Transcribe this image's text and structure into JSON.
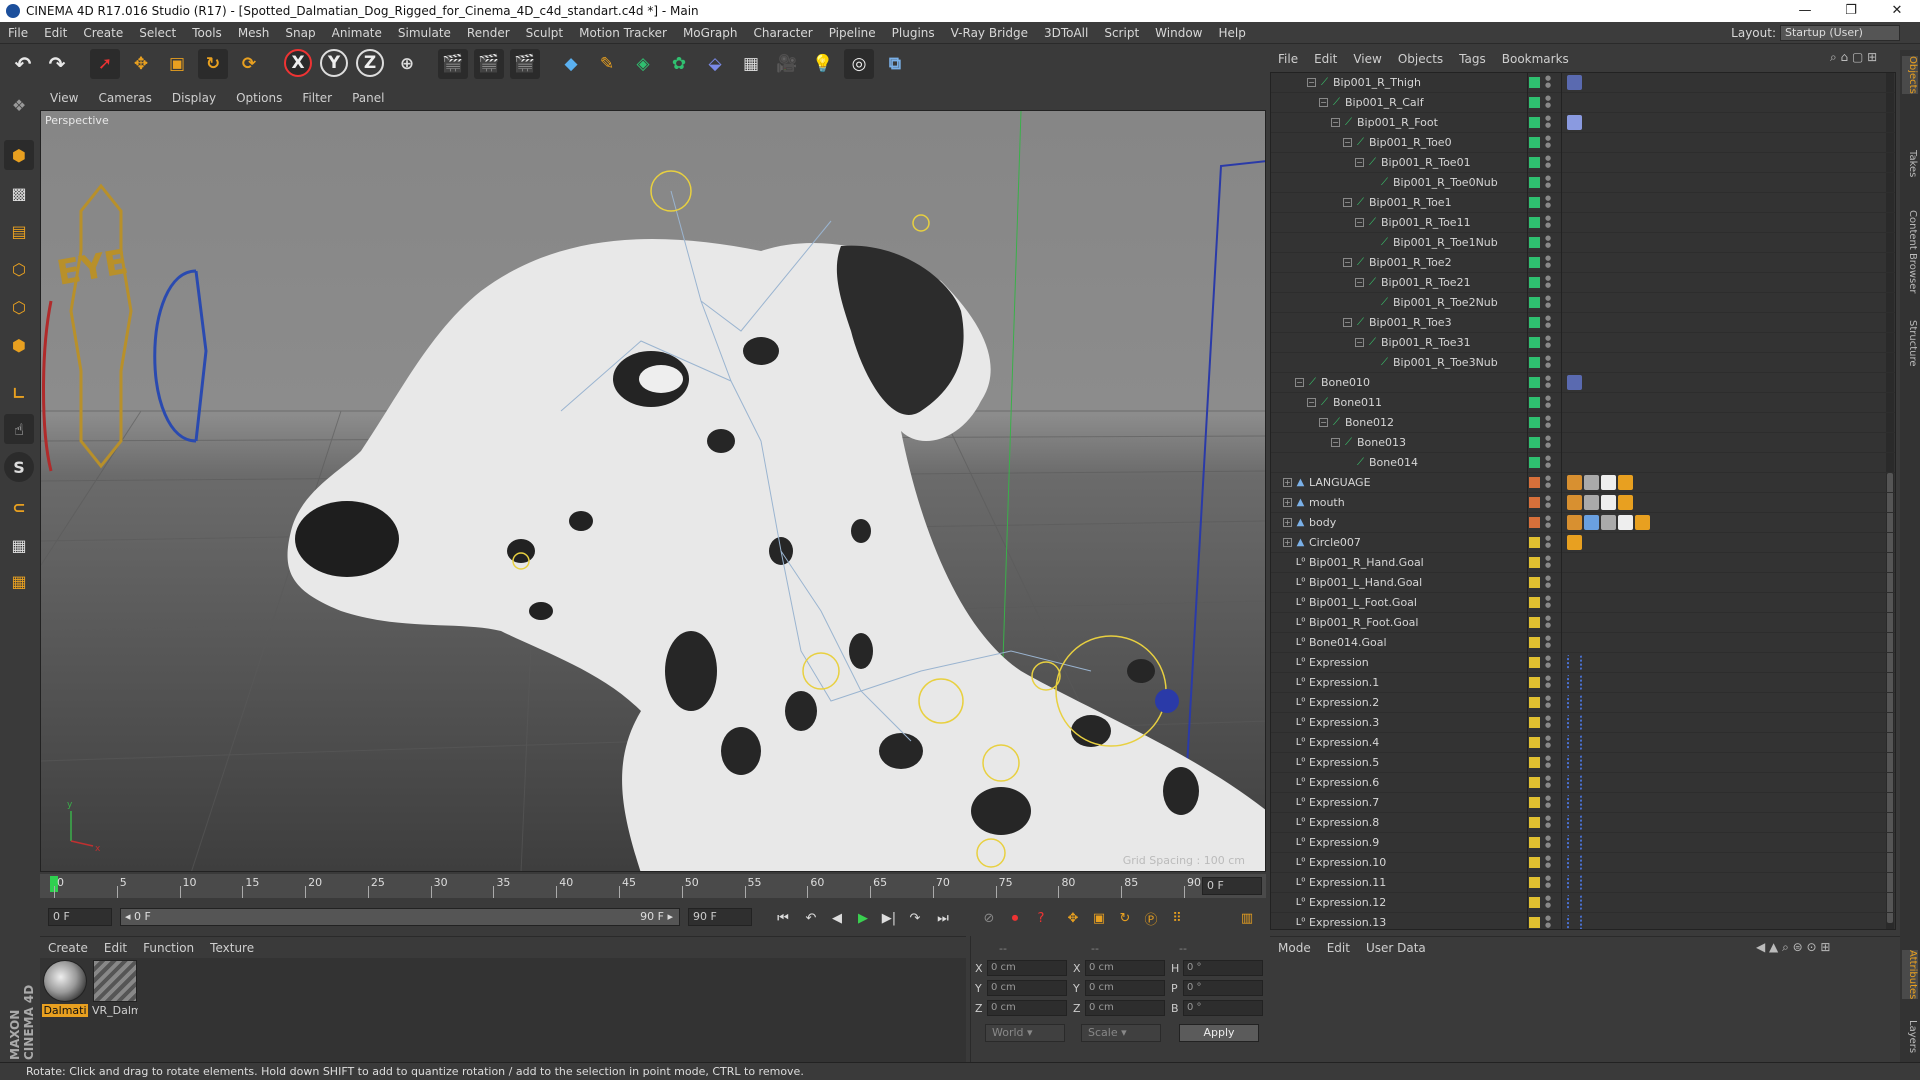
{
  "window": {
    "title": "CINEMA 4D R17.016 Studio (R17) - [Spotted_Dalmatian_Dog_Rigged_for_Cinema_4D_c4d_standart.c4d *] - Main",
    "minimize": "—",
    "restore": "❐",
    "close": "✕"
  },
  "menu": [
    "File",
    "Edit",
    "Create",
    "Select",
    "Tools",
    "Mesh",
    "Snap",
    "Animate",
    "Simulate",
    "Render",
    "Sculpt",
    "Motion Tracker",
    "MoGraph",
    "Character",
    "Pipeline",
    "Plugins",
    "V-Ray Bridge",
    "3DToAll",
    "Script",
    "Window",
    "Help"
  ],
  "layout": {
    "label": "Layout:",
    "value": "Startup (User)"
  },
  "toolbar": {
    "x_label": "X",
    "y_label": "Y",
    "z_label": "Z"
  },
  "viewport": {
    "menu": [
      "View",
      "Cameras",
      "Display",
      "Options",
      "Filter",
      "Panel"
    ],
    "label": "Perspective",
    "grid_spacing": "Grid Spacing : 100 cm",
    "controller_text": "EYE",
    "axis_y": "y",
    "axis_x": "x"
  },
  "timeline": {
    "ticks": [
      "0",
      "5",
      "10",
      "15",
      "20",
      "25",
      "30",
      "35",
      "40",
      "45",
      "50",
      "55",
      "60",
      "65",
      "70",
      "75",
      "80",
      "85",
      "90"
    ],
    "current_frame": "0 F",
    "start_field": "0 F",
    "range_start": "◂ 0 F",
    "range_end": "90 F ▸",
    "end_field": "90 F"
  },
  "materials": {
    "menu": [
      "Create",
      "Edit",
      "Function",
      "Texture"
    ],
    "items": [
      {
        "name": "Dalmati"
      },
      {
        "name": "VR_Dalm"
      }
    ]
  },
  "coords": {
    "header_a": "--",
    "header_b": "--",
    "header_c": "--",
    "rows": [
      {
        "l1": "X",
        "v1": "0 cm",
        "l2": "X",
        "v2": "0 cm",
        "l3": "H",
        "v3": "0 °"
      },
      {
        "l1": "Y",
        "v1": "0 cm",
        "l2": "Y",
        "v2": "0 cm",
        "l3": "P",
        "v3": "0 °"
      },
      {
        "l1": "Z",
        "v1": "0 cm",
        "l2": "Z",
        "v2": "0 cm",
        "l3": "B",
        "v3": "0 °"
      }
    ],
    "world": "World",
    "scale": "Scale",
    "apply": "Apply"
  },
  "object_manager": {
    "menu": [
      "File",
      "Edit",
      "View",
      "Objects",
      "Tags",
      "Bookmarks"
    ],
    "rows": [
      {
        "name": "Bip001_R_Thigh",
        "indent": 2,
        "type": "bone",
        "color": "#2fc070",
        "tags": [
          "ik"
        ]
      },
      {
        "name": "Bip001_R_Calf",
        "indent": 3,
        "type": "bone",
        "color": "#2fc070",
        "tags": []
      },
      {
        "name": "Bip001_R_Foot",
        "indent": 4,
        "type": "bone",
        "color": "#2fc070",
        "tags": [
          "ik2"
        ]
      },
      {
        "name": "Bip001_R_Toe0",
        "indent": 5,
        "type": "bone",
        "color": "#2fc070",
        "tags": []
      },
      {
        "name": "Bip001_R_Toe01",
        "indent": 6,
        "type": "bone",
        "color": "#2fc070",
        "tags": []
      },
      {
        "name": "Bip001_R_Toe0Nub",
        "indent": 7,
        "type": "bone",
        "color": "#2fc070",
        "tags": []
      },
      {
        "name": "Bip001_R_Toe1",
        "indent": 5,
        "type": "bone",
        "color": "#2fc070",
        "tags": []
      },
      {
        "name": "Bip001_R_Toe11",
        "indent": 6,
        "type": "bone",
        "color": "#2fc070",
        "tags": []
      },
      {
        "name": "Bip001_R_Toe1Nub",
        "indent": 7,
        "type": "bone",
        "color": "#2fc070",
        "tags": []
      },
      {
        "name": "Bip001_R_Toe2",
        "indent": 5,
        "type": "bone",
        "color": "#2fc070",
        "tags": []
      },
      {
        "name": "Bip001_R_Toe21",
        "indent": 6,
        "type": "bone",
        "color": "#2fc070",
        "tags": []
      },
      {
        "name": "Bip001_R_Toe2Nub",
        "indent": 7,
        "type": "bone",
        "color": "#2fc070",
        "tags": []
      },
      {
        "name": "Bip001_R_Toe3",
        "indent": 5,
        "type": "bone",
        "color": "#2fc070",
        "tags": []
      },
      {
        "name": "Bip001_R_Toe31",
        "indent": 6,
        "type": "bone",
        "color": "#2fc070",
        "tags": []
      },
      {
        "name": "Bip001_R_Toe3Nub",
        "indent": 7,
        "type": "bone",
        "color": "#2fc070",
        "tags": []
      },
      {
        "name": "Bone010",
        "indent": 1,
        "type": "bone",
        "color": "#2fc070",
        "tags": [
          "ik"
        ]
      },
      {
        "name": "Bone011",
        "indent": 2,
        "type": "bone",
        "color": "#2fc070",
        "tags": []
      },
      {
        "name": "Bone012",
        "indent": 3,
        "type": "bone",
        "color": "#2fc070",
        "tags": []
      },
      {
        "name": "Bone013",
        "indent": 4,
        "type": "bone",
        "color": "#2fc070",
        "tags": []
      },
      {
        "name": "Bone014",
        "indent": 5,
        "type": "bone",
        "color": "#2fc070",
        "tags": []
      },
      {
        "name": "LANGUAGE",
        "indent": 0,
        "type": "poly",
        "color": "#d8703a",
        "tags": [
          "w",
          "s",
          "c",
          "d"
        ]
      },
      {
        "name": "mouth",
        "indent": 0,
        "type": "poly",
        "color": "#d8703a",
        "tags": [
          "w",
          "s",
          "c",
          "d"
        ]
      },
      {
        "name": "body",
        "indent": 0,
        "type": "poly",
        "color": "#d8703a",
        "tags": [
          "w",
          "v",
          "s",
          "c",
          "d"
        ]
      },
      {
        "name": "Circle007",
        "indent": 0,
        "type": "poly",
        "color": "#e0c030",
        "tags": [
          "d"
        ]
      },
      {
        "name": "Bip001_R_Hand.Goal",
        "indent": 0,
        "type": "null",
        "color": "#e0c030",
        "tags": []
      },
      {
        "name": "Bip001_L_Hand.Goal",
        "indent": 0,
        "type": "null",
        "color": "#e0c030",
        "tags": []
      },
      {
        "name": "Bip001_L_Foot.Goal",
        "indent": 0,
        "type": "null",
        "color": "#e0c030",
        "tags": []
      },
      {
        "name": "Bip001_R_Foot.Goal",
        "indent": 0,
        "type": "null",
        "color": "#e0c030",
        "tags": []
      },
      {
        "name": "Bone014.Goal",
        "indent": 0,
        "type": "null",
        "color": "#e0c030",
        "tags": []
      },
      {
        "name": "Expression",
        "indent": 0,
        "type": "null",
        "color": "#e0c030",
        "tags": [
          "x"
        ]
      },
      {
        "name": "Expression.1",
        "indent": 0,
        "type": "null",
        "color": "#e0c030",
        "tags": [
          "x"
        ]
      },
      {
        "name": "Expression.2",
        "indent": 0,
        "type": "null",
        "color": "#e0c030",
        "tags": [
          "x"
        ]
      },
      {
        "name": "Expression.3",
        "indent": 0,
        "type": "null",
        "color": "#e0c030",
        "tags": [
          "x"
        ]
      },
      {
        "name": "Expression.4",
        "indent": 0,
        "type": "null",
        "color": "#e0c030",
        "tags": [
          "x"
        ]
      },
      {
        "name": "Expression.5",
        "indent": 0,
        "type": "null",
        "color": "#e0c030",
        "tags": [
          "x"
        ]
      },
      {
        "name": "Expression.6",
        "indent": 0,
        "type": "null",
        "color": "#e0c030",
        "tags": [
          "x"
        ]
      },
      {
        "name": "Expression.7",
        "indent": 0,
        "type": "null",
        "color": "#e0c030",
        "tags": [
          "x"
        ]
      },
      {
        "name": "Expression.8",
        "indent": 0,
        "type": "null",
        "color": "#e0c030",
        "tags": [
          "x"
        ]
      },
      {
        "name": "Expression.9",
        "indent": 0,
        "type": "null",
        "color": "#e0c030",
        "tags": [
          "x"
        ]
      },
      {
        "name": "Expression.10",
        "indent": 0,
        "type": "null",
        "color": "#e0c030",
        "tags": [
          "x"
        ]
      },
      {
        "name": "Expression.11",
        "indent": 0,
        "type": "null",
        "color": "#e0c030",
        "tags": [
          "x"
        ]
      },
      {
        "name": "Expression.12",
        "indent": 0,
        "type": "null",
        "color": "#e0c030",
        "tags": [
          "x"
        ]
      },
      {
        "name": "Expression.13",
        "indent": 0,
        "type": "null",
        "color": "#e0c030",
        "tags": [
          "x"
        ]
      }
    ]
  },
  "attributes": {
    "menu": [
      "Mode",
      "Edit",
      "User Data"
    ]
  },
  "right_tabs": [
    "Objects",
    "Takes",
    "Content Browser",
    "Structure",
    "Attributes",
    "Layers"
  ],
  "branding": "MAXON CINEMA 4D",
  "status": "Rotate: Click and drag to rotate elements. Hold down SHIFT to add to quantize rotation / add to the selection in point mode, CTRL to remove."
}
